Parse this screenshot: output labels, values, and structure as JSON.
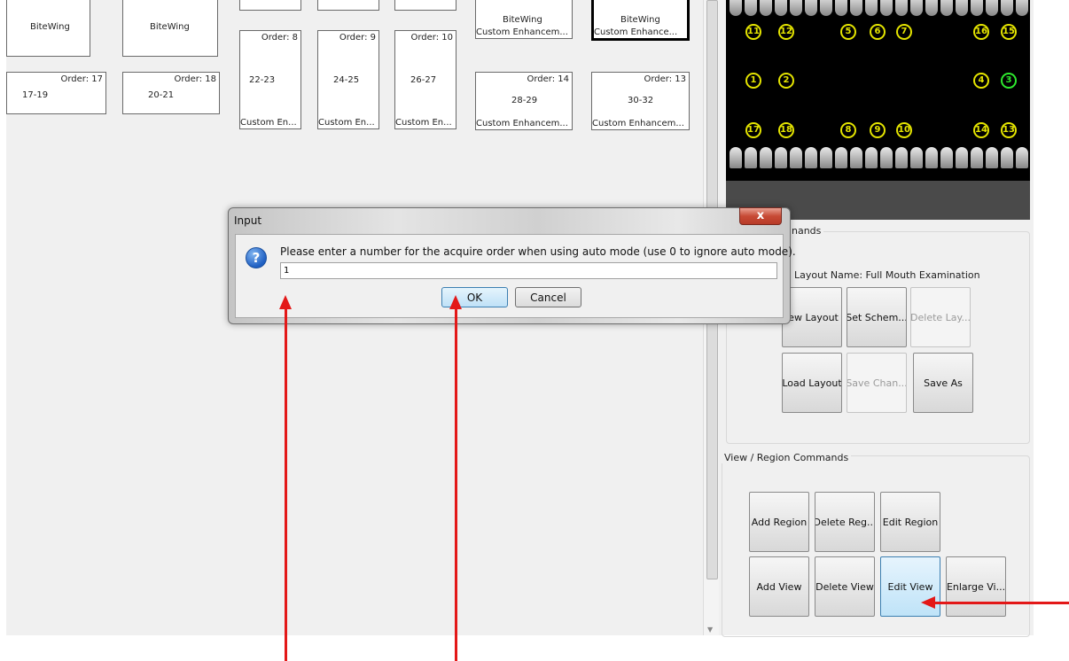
{
  "layout": {
    "cells": [
      {
        "label": "BiteWing"
      },
      {
        "label": "BiteWing"
      },
      {
        "order": "Order: 8",
        "range": "22-23",
        "custom": "Custom En..."
      },
      {
        "order": "Order: 9",
        "range": "24-25",
        "custom": "Custom En..."
      },
      {
        "order": "Order: 10",
        "range": "26-27",
        "custom": "Custom En..."
      },
      {
        "label": "BiteWing",
        "custom": "Custom Enhancem..."
      },
      {
        "label": "BiteWing",
        "custom": "Custom Enhance..."
      },
      {
        "order": "Order: 17",
        "range": "17-19"
      },
      {
        "order": "Order: 18",
        "range": "20-21"
      },
      {
        "order": "Order: 14",
        "range": "28-29",
        "custom": "Custom Enhancem..."
      },
      {
        "order": "Order: 13",
        "range": "30-32",
        "custom": "Custom Enhancem..."
      }
    ]
  },
  "preview": {
    "numbers": [
      "11",
      "12",
      "5",
      "6",
      "7",
      "16",
      "15",
      "1",
      "2",
      "4",
      "3",
      "17",
      "18",
      "8",
      "9",
      "10",
      "14",
      "13"
    ],
    "active_number": "3"
  },
  "layout_commands": {
    "title": "nands",
    "layout_name": "Layout Name: Full Mouth Examination",
    "buttons": [
      {
        "label": "lew Layout",
        "enabled": true
      },
      {
        "label": "Set Schem...",
        "enabled": true
      },
      {
        "label": "Delete Lay...",
        "enabled": false
      },
      {
        "label": "Load Layout",
        "enabled": true
      },
      {
        "label": "Save Chan...",
        "enabled": false
      },
      {
        "label": "Save As",
        "enabled": true
      }
    ]
  },
  "view_region_commands": {
    "title": "View / Region Commands",
    "buttons": [
      {
        "label": "Add Region"
      },
      {
        "label": "Delete Reg..."
      },
      {
        "label": "Edit Region"
      },
      {
        "label": "Add View"
      },
      {
        "label": "Delete View"
      },
      {
        "label": "Edit View"
      },
      {
        "label": "Enlarge Vi..."
      }
    ]
  },
  "dialog": {
    "title": "Input",
    "close_glyph": "x",
    "icon_glyph": "?",
    "prompt": "Please enter a number for the acquire order when using auto mode (use 0 to ignore auto mode).",
    "value": "1",
    "ok_label": "OK",
    "cancel_label": "Cancel"
  },
  "colors": {
    "annotation_arrow": "#e31818",
    "tooth_number": "#e4e400",
    "tooth_number_active": "#2ee82e"
  }
}
